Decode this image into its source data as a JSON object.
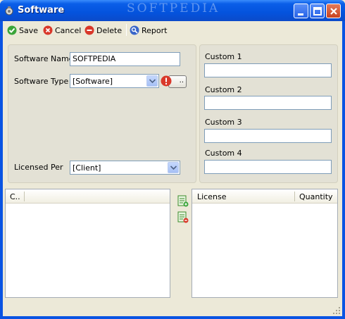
{
  "window": {
    "title": "Software",
    "watermark": "SOFTPEDIA"
  },
  "toolbar": {
    "save": "Save",
    "cancel": "Cancel",
    "delete": "Delete",
    "report": "Report"
  },
  "form": {
    "software_name_label": "Software Name",
    "software_name_value": "SOFTPEDIA",
    "software_type_label": "Software Type",
    "software_type_value": "[Software]",
    "ellipsis": "..",
    "licensed_per_label": "Licensed Per",
    "licensed_per_value": "[Client]"
  },
  "custom": {
    "c1": "Custom 1",
    "c2": "Custom 2",
    "c3": "Custom 3",
    "c4": "Custom 4"
  },
  "left_list": {
    "col1": "C.."
  },
  "right_list": {
    "col1": "License",
    "col2": "Quantity"
  },
  "colors": {
    "title_blue": "#0453dd",
    "face": "#ece9d8",
    "panel": "#e3e1d5"
  }
}
